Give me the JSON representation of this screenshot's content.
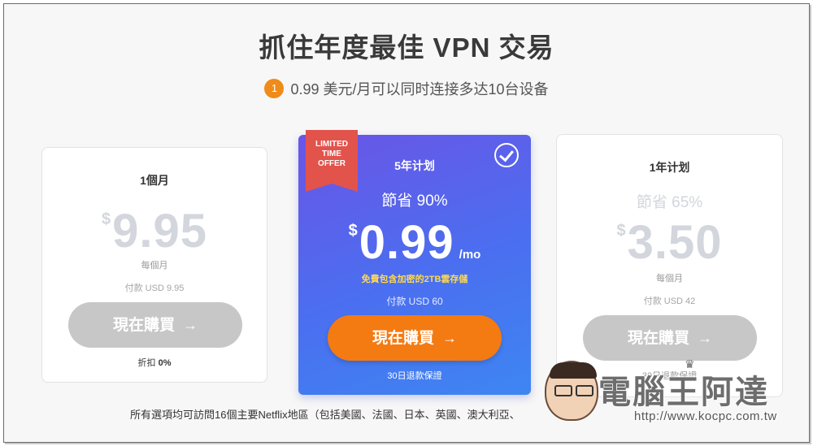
{
  "header": {
    "title": "抓住年度最佳 VPN 交易",
    "subtitle_badge": "1",
    "subtitle": "0.99 美元/月可以同时连接多达10台设备"
  },
  "plans": {
    "monthly": {
      "name": "1個月",
      "currency": "$",
      "price": "9.95",
      "per_month": "每個月",
      "payment": "付款 USD 9.95",
      "button": "現在購買",
      "discount_label": "折扣",
      "discount_value": "0%"
    },
    "five_year": {
      "ribbon": [
        "LIMITED",
        "TIME",
        "OFFER"
      ],
      "name": "5年计划",
      "save": "節省 90%",
      "currency": "$",
      "price": "0.99",
      "per": "/mo",
      "promo": "免費包含加密的2TB雲存儲",
      "payment": "付款 USD 60",
      "button": "現在購買",
      "guarantee": "30日退款保證"
    },
    "one_year": {
      "name": "1年计划",
      "save": "節省 65%",
      "currency": "$",
      "price": "3.50",
      "per_month": "每個月",
      "payment": "付款 USD 42",
      "button": "現在購買",
      "guarantee": "30日退款保證"
    }
  },
  "footnote": "所有選項均可訪問16個主要Netflix地區（包括美國、法國、日本、英國、澳大利亞、",
  "watermark": {
    "brand": "電腦王阿達",
    "url": "http://www.kocpc.com.tw"
  },
  "icons": {
    "arrow": "→",
    "check": "check-circle-icon"
  },
  "colors": {
    "accent": "#f47a12",
    "badge": "#f08a18",
    "featured_gradient_start": "#6a55e6",
    "featured_gradient_end": "#3e86f2",
    "ribbon": "#e2534c",
    "promo_text": "#ffd94d",
    "disabled_button": "#c7c7c7"
  }
}
